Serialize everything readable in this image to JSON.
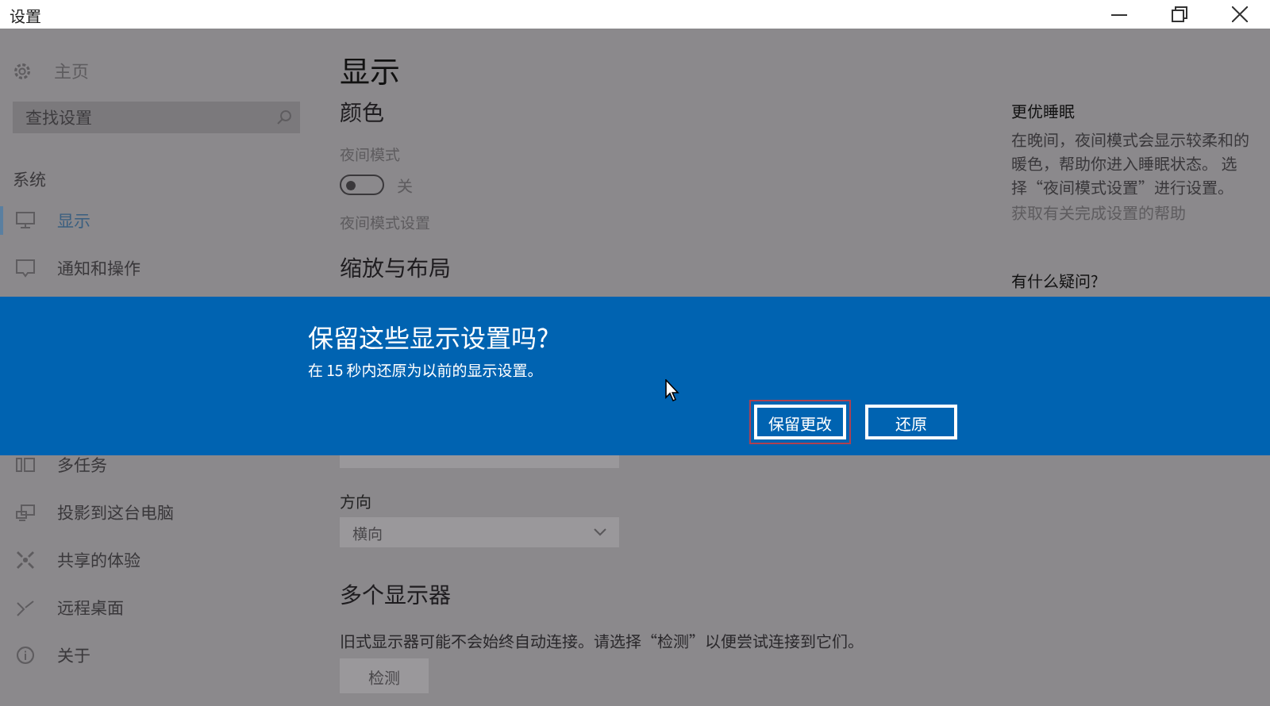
{
  "window": {
    "title": "设置"
  },
  "sidebar": {
    "home": "主页",
    "search": {
      "placeholder": "查找设置"
    },
    "section": "系统",
    "items": [
      {
        "label": "显示",
        "kind": "monitor",
        "selected": true
      },
      {
        "label": "通知和操作",
        "kind": "message",
        "selected": false
      },
      {
        "label": "多任务",
        "kind": "multitask",
        "selected": false
      },
      {
        "label": "投影到这台电脑",
        "kind": "project",
        "selected": false
      },
      {
        "label": "共享的体验",
        "kind": "share",
        "selected": false
      },
      {
        "label": "远程桌面",
        "kind": "remote",
        "selected": false
      },
      {
        "label": "关于",
        "kind": "info",
        "selected": false
      }
    ]
  },
  "content": {
    "title": "显示",
    "color_heading": "颜色",
    "night_label": "夜间模式",
    "night_toggle": {
      "on": false,
      "state_text": "关"
    },
    "night_link": "夜间模式设置",
    "scale_heading": "缩放与布局",
    "orientation_label": "方向",
    "orientation": {
      "value": "横向"
    },
    "multi_heading": "多个显示器",
    "multi_text": "旧式显示器可能不会始终自动连接。请选择“检测”以便尝试连接到它们。",
    "detect_button": "检测"
  },
  "aside": {
    "sleep_heading": "更优睡眠",
    "sleep_text": "在晚间，夜间模式会显示较柔和的暖色，帮助你进入睡眠状态。 选择“夜间模式设置”进行设置。",
    "sleep_link": "获取有关完成设置的帮助",
    "question_heading": "有什么疑问?"
  },
  "dialog": {
    "title": "保留这些显示设置吗?",
    "message": "在 15 秒内还原为以前的显示设置。",
    "buttons": [
      {
        "label": "保留更改",
        "focused": true
      },
      {
        "label": "还原",
        "focused": false
      }
    ]
  }
}
